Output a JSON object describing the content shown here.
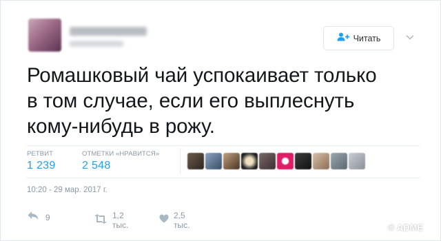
{
  "header": {
    "follow_label": "Читать",
    "follow_icon": "user-plus-icon",
    "more_icon": "chevron-down-icon"
  },
  "tweet": {
    "text_lines": [
      "Ромашковый чай успокаивает только",
      "в том случае, если его выплеснуть",
      "кому-нибудь в рожу."
    ],
    "timestamp": "10:20 - 29 мар. 2017 г."
  },
  "stats": {
    "retweets_label": "РЕТВИТ",
    "retweets_value": "1 239",
    "likes_label": "ОТМЕТКИ «НРАВИТСЯ»",
    "likes_value": "2 548"
  },
  "actions": {
    "reply_count": "9",
    "retweet_count": "1,2 тыс.",
    "like_count": "2,5 тыс."
  },
  "watermark": "© ADME",
  "colors": {
    "accent": "#1da1f2",
    "text": "#14171a",
    "muted": "#8899a6",
    "border": "#e6ecf0"
  }
}
